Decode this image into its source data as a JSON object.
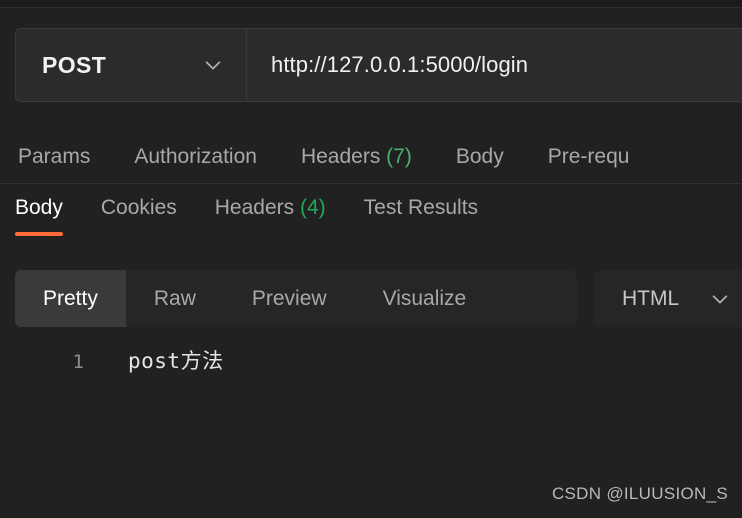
{
  "app": {
    "background_color": "#212121",
    "accent_color": "#ff6c37",
    "count_color": "#4aaf6e"
  },
  "request_bar": {
    "method": "POST",
    "method_chevron_icon": "chevron-down-icon",
    "url": "http://127.0.0.1:5000/login"
  },
  "request_tabs": [
    {
      "label": "Params",
      "count": "",
      "active": false
    },
    {
      "label": "Authorization",
      "count": "",
      "active": false
    },
    {
      "label": "Headers",
      "count": "(7)",
      "active": false
    },
    {
      "label": "Body",
      "count": "",
      "active": false
    },
    {
      "label": "Pre-requ",
      "count": "",
      "active": false
    }
  ],
  "response_tabs": [
    {
      "label": "Body",
      "count": "",
      "active": true
    },
    {
      "label": "Cookies",
      "count": "",
      "active": false
    },
    {
      "label": "Headers",
      "count": "(4)",
      "active": false
    },
    {
      "label": "Test Results",
      "count": "",
      "active": false
    }
  ],
  "format_toolbar": {
    "buttons": [
      {
        "label": "Pretty",
        "active": true
      },
      {
        "label": "Raw",
        "active": false
      },
      {
        "label": "Preview",
        "active": false
      },
      {
        "label": "Visualize",
        "active": false
      }
    ],
    "language": "HTML",
    "language_chevron_icon": "chevron-down-icon"
  },
  "response_body": {
    "lines": [
      {
        "number": "1",
        "text": "post方法"
      }
    ]
  },
  "watermark": {
    "text": "CSDN @ILUUSION_S"
  }
}
